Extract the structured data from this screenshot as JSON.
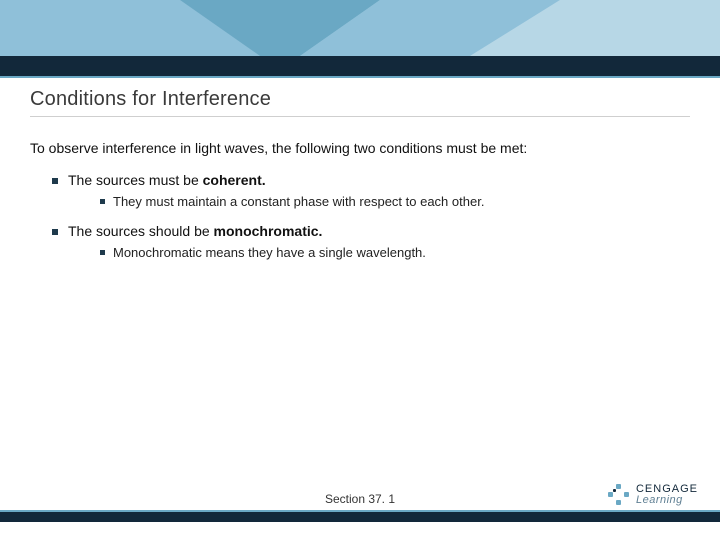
{
  "title": "Conditions for Interference",
  "intro": "To observe interference in light waves, the following two conditions must be met:",
  "bullets": [
    {
      "text_prefix": "The sources must be ",
      "text_bold": "coherent.",
      "sub": "They must maintain a constant phase with respect to each other."
    },
    {
      "text_prefix": "The sources should be ",
      "text_bold": "monochromatic.",
      "sub": "Monochromatic means they have a single wavelength."
    }
  ],
  "section_label": "Section  37. 1",
  "logo": {
    "line1": "CENGAGE",
    "line2": "Learning"
  },
  "colors": {
    "dark_navy": "#12283a",
    "mid_blue": "#6aa8c4",
    "light_blue": "#a8cde0"
  }
}
